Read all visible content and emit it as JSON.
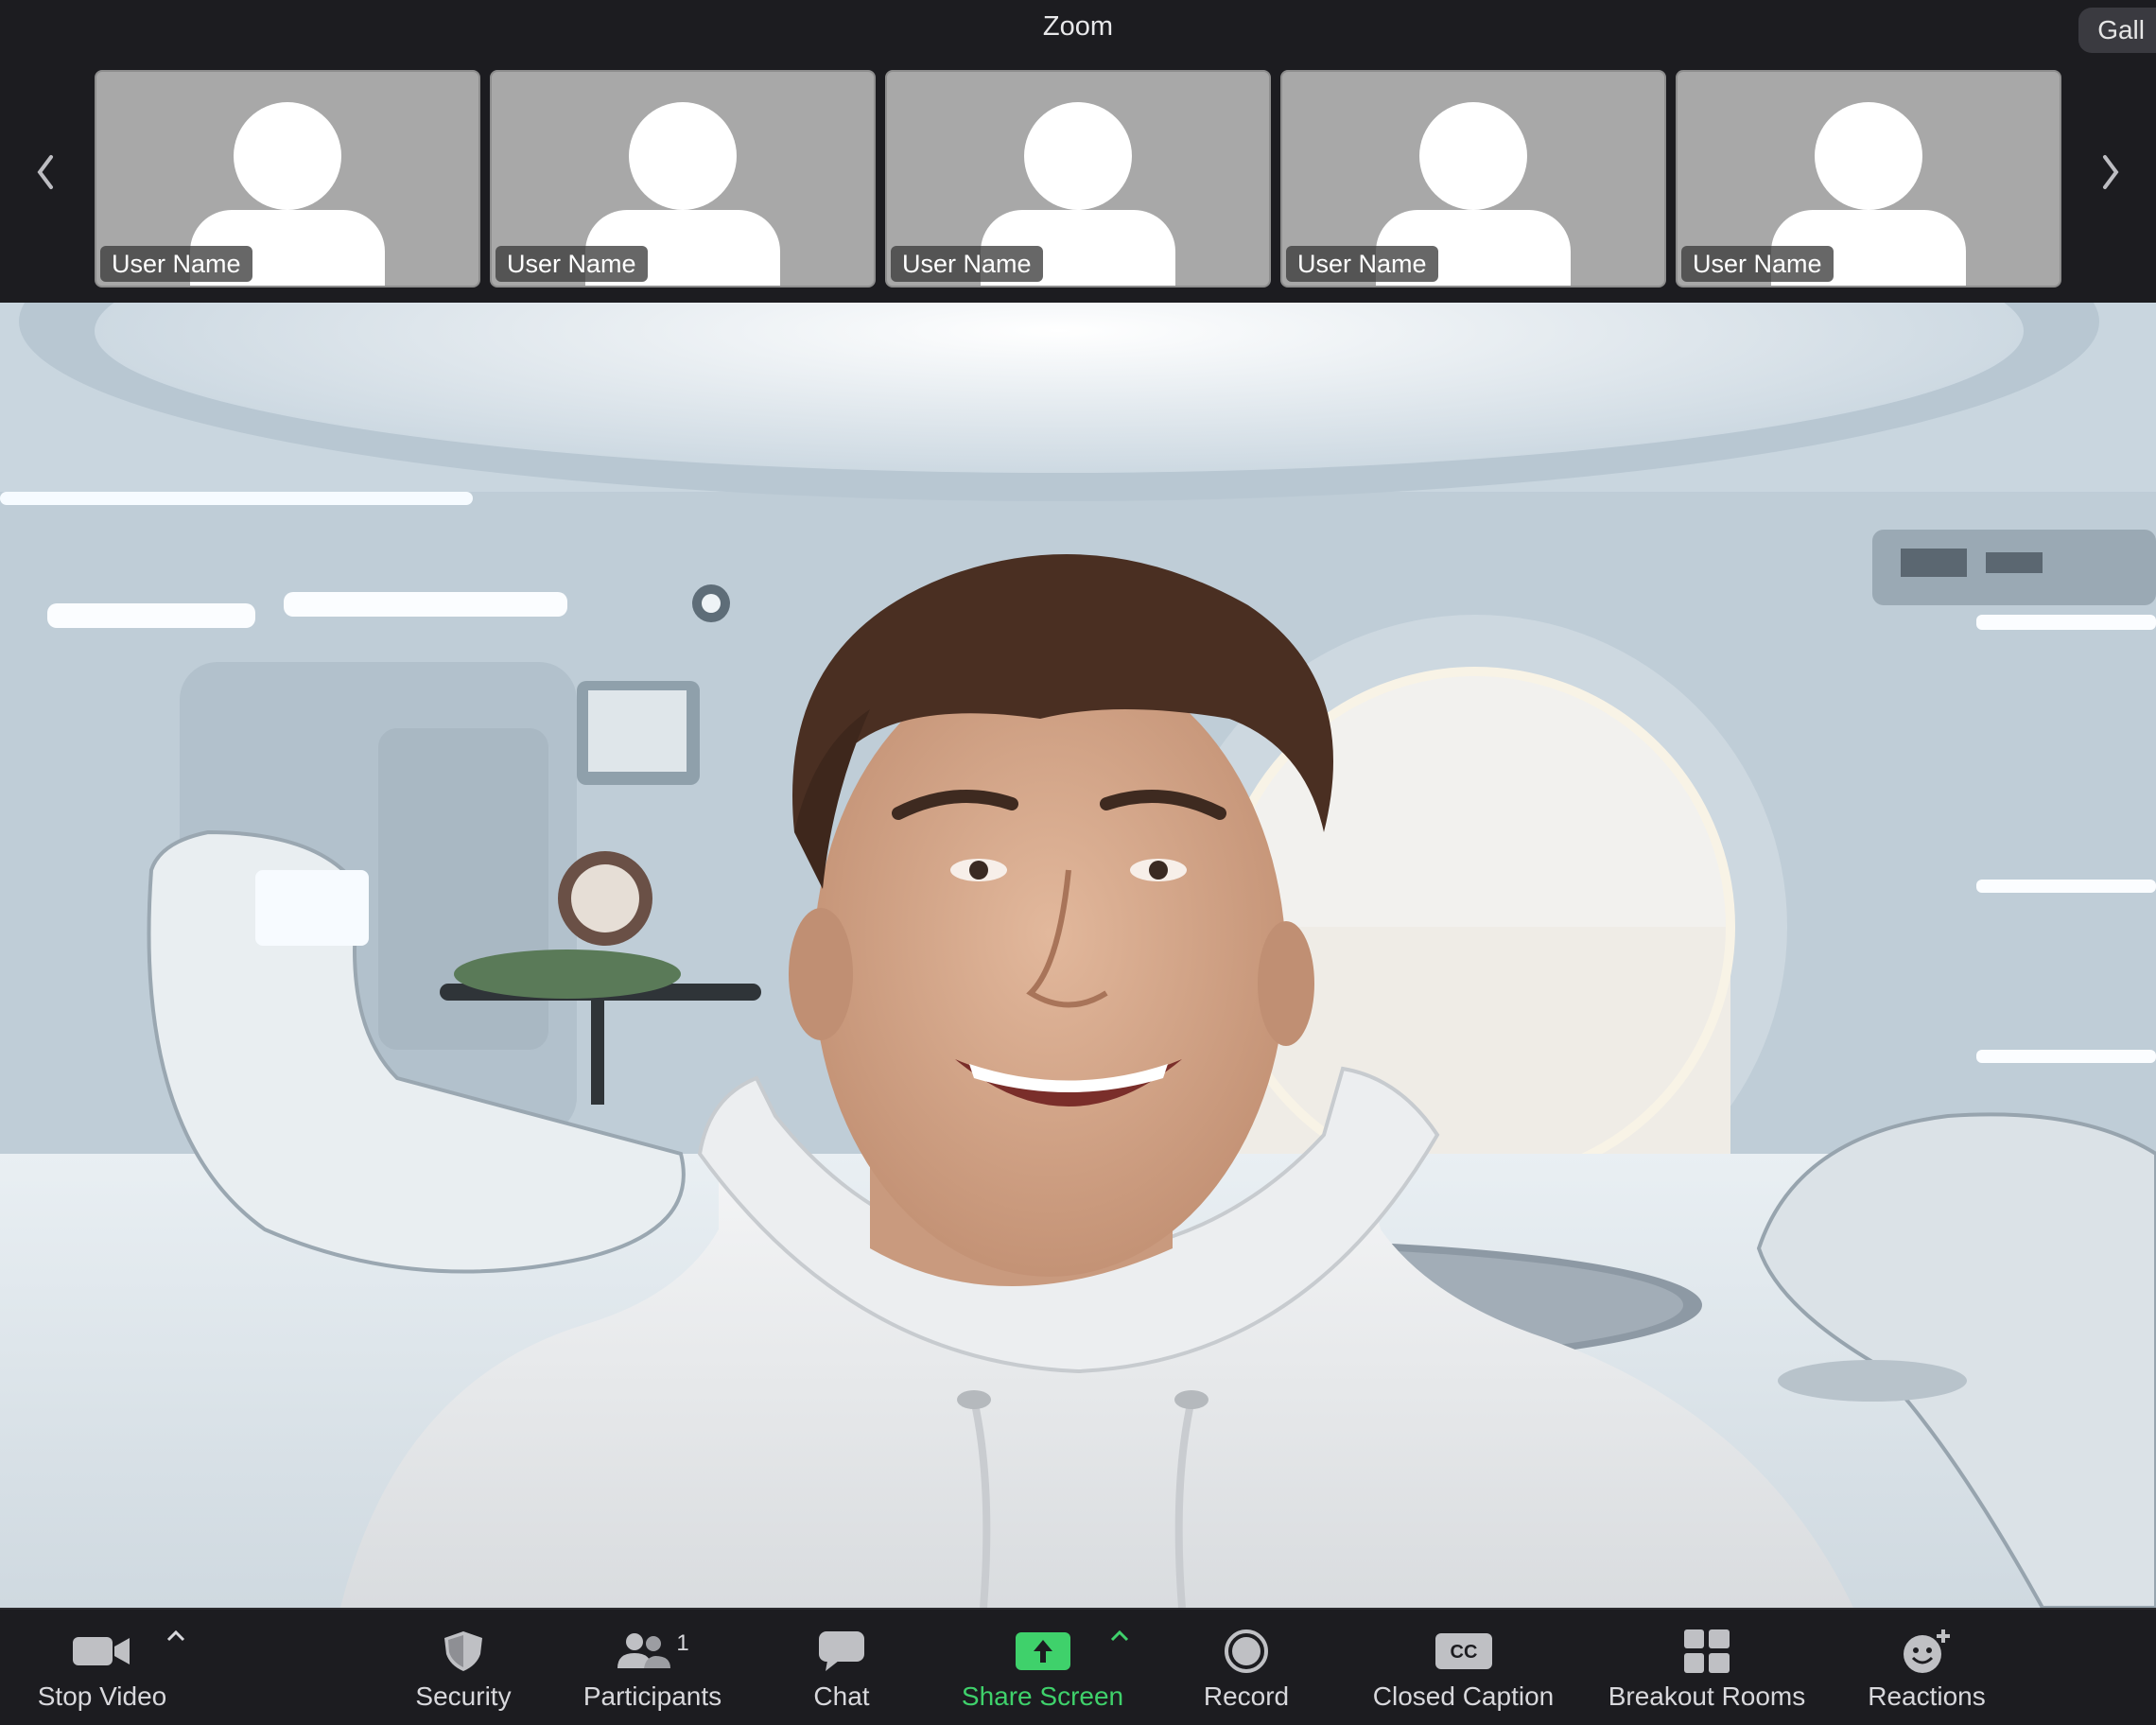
{
  "window": {
    "title": "Zoom",
    "view_button": "Gall"
  },
  "thumbnails": [
    {
      "name": "User Name"
    },
    {
      "name": "User Name"
    },
    {
      "name": "User Name"
    },
    {
      "name": "User Name"
    },
    {
      "name": "User Name"
    }
  ],
  "controls": {
    "stop_video": "Stop Video",
    "security": "Security",
    "participants": "Participants",
    "participants_count": "1",
    "chat": "Chat",
    "share_screen": "Share Screen",
    "record": "Record",
    "closed_caption": "Closed Caption",
    "closed_caption_icon_text": "CC",
    "breakout_rooms": "Breakout Rooms",
    "reactions": "Reactions"
  },
  "colors": {
    "share_accent": "#3fd16b",
    "bar_bg": "#1c1c20"
  }
}
